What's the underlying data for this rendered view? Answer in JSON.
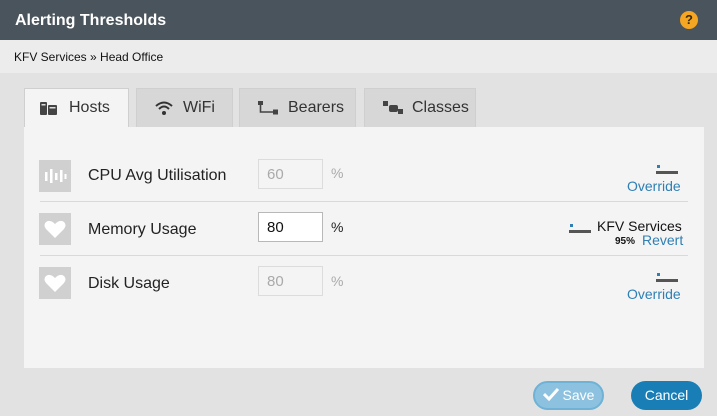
{
  "dialog": {
    "title": "Alerting Thresholds",
    "help_glyph": "?"
  },
  "breadcrumb": "KFV Services » Head Office",
  "tabs": [
    {
      "label": "Hosts",
      "icon": "hosts-icon",
      "active": true
    },
    {
      "label": "WiFi",
      "icon": "wifi-icon",
      "active": false
    },
    {
      "label": "Bearers",
      "icon": "bearers-icon",
      "active": false
    },
    {
      "label": "Classes",
      "icon": "classes-icon",
      "active": false
    }
  ],
  "rows": [
    {
      "icon": "cpu-icon",
      "label": "CPU Avg Utilisation",
      "value": "60",
      "unit": "%",
      "editable": false,
      "action": "Override"
    },
    {
      "icon": "heart-icon",
      "label": "Memory Usage",
      "value": "80",
      "unit": "%",
      "editable": true,
      "inherited_from": "KFV Services",
      "inherited_value": "95%",
      "action": "Revert"
    },
    {
      "icon": "heart-icon",
      "label": "Disk Usage",
      "value": "80",
      "unit": "%",
      "editable": false,
      "action": "Override"
    }
  ],
  "buttons": {
    "save": "Save",
    "cancel": "Cancel"
  },
  "colors": {
    "titlebar": "#4a545c",
    "accent": "#1a7eb6",
    "link": "#2f7fb4",
    "help": "#f5a623"
  }
}
